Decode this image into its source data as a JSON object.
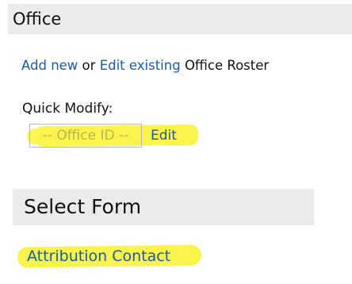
{
  "office_section": {
    "title": "Office"
  },
  "roster": {
    "add_new_label": "Add new",
    "or_text": "or",
    "edit_existing_label": "Edit existing",
    "roster_text": "Office Roster"
  },
  "quick_modify": {
    "label": "Quick Modify:",
    "office_id_placeholder": "-- Office ID --",
    "edit_label": "Edit"
  },
  "select_form": {
    "title": "Select Form",
    "items": [
      {
        "label": "Attribution Contact"
      }
    ]
  },
  "colors": {
    "link": "#1a5ba8",
    "highlight": "#fbf44d",
    "header_bg": "#ebebeb"
  }
}
